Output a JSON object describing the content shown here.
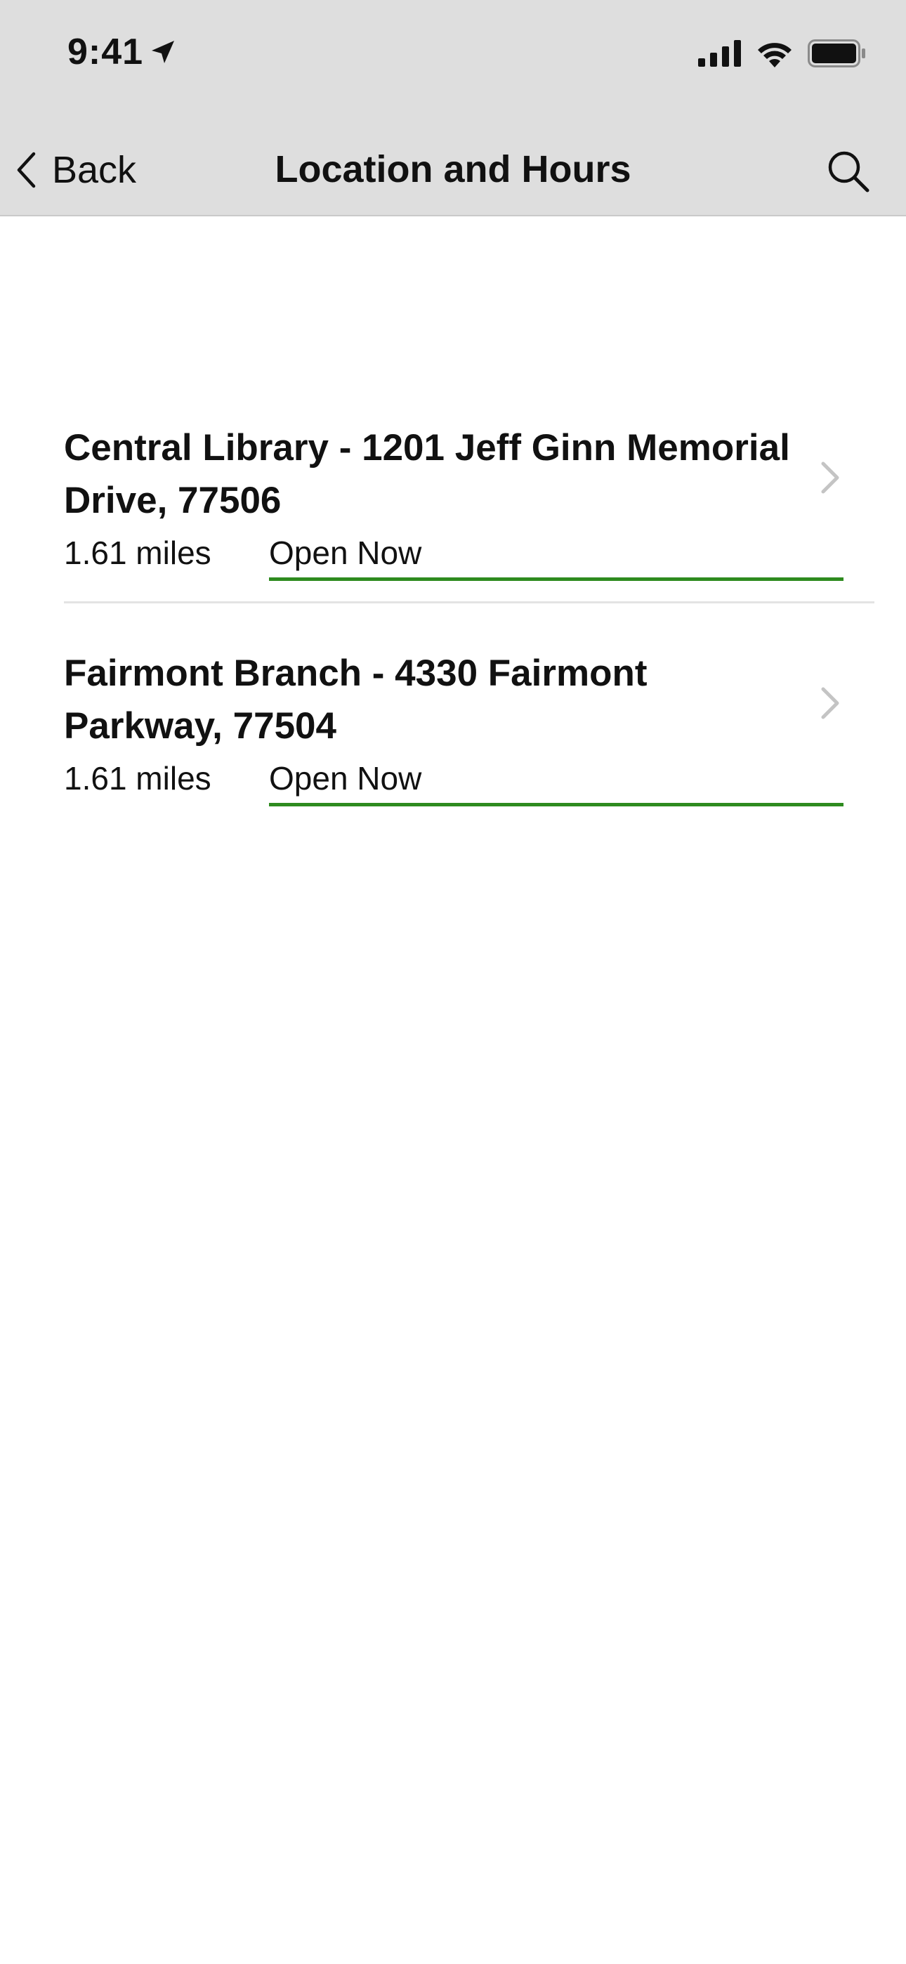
{
  "status_bar": {
    "time": "9:41"
  },
  "nav": {
    "back_label": "Back",
    "title": "Location and Hours"
  },
  "colors": {
    "header_bg": "#dedede",
    "open_accent": "#2e8b1f",
    "chevron": "#c4c4c4"
  },
  "locations": [
    {
      "name": "Central Library - 1201 Jeff Ginn Memorial Drive, 77506",
      "distance": "1.61 miles",
      "status": "Open Now"
    },
    {
      "name": "Fairmont Branch - 4330 Fairmont Parkway, 77504",
      "distance": "1.61 miles",
      "status": "Open Now"
    }
  ]
}
